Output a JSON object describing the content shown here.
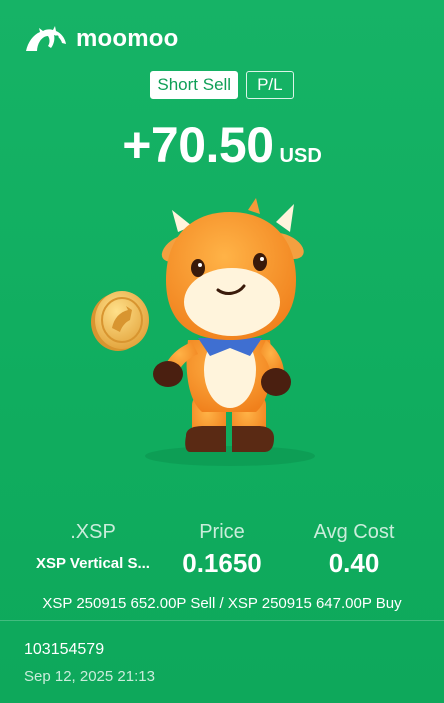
{
  "brand": {
    "name": "moomoo",
    "logo_icon": "bull-logo-icon"
  },
  "tags": {
    "primary": "Short Sell",
    "secondary": "P/L"
  },
  "pnl": {
    "value": "+70.50",
    "currency": "USD"
  },
  "illustration": {
    "icon": "moomoo-mascot-with-coin"
  },
  "stats": {
    "underlying_label": ".XSP",
    "underlying_value": "XSP Vertical S...",
    "price_label": "Price",
    "price_value": "0.1650",
    "avg_cost_label": "Avg Cost",
    "avg_cost_value": "0.40"
  },
  "legs_text": "XSP 250915 652.00P Sell / XSP 250915 647.00P Buy",
  "order": {
    "id": "103154579",
    "time": "Sep 12, 2025 21:13"
  },
  "colors": {
    "background": "#12b063",
    "text": "#ffffff",
    "tag_text": "#0f9f57"
  }
}
